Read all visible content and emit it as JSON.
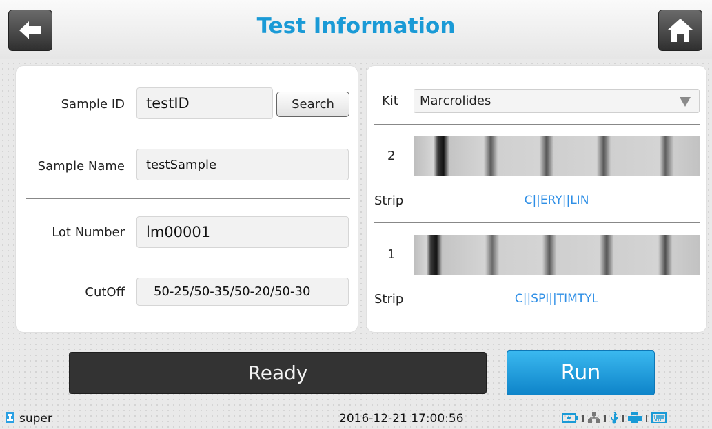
{
  "header": {
    "title": "Test Information",
    "back_icon": "arrow-left-icon",
    "home_icon": "home-icon"
  },
  "left_panel": {
    "sample_id_label": "Sample ID",
    "sample_id_value": "testID",
    "search_label": "Search",
    "sample_name_label": "Sample Name",
    "sample_name_value": "testSample",
    "lot_number_label": "Lot Number",
    "lot_number_value": "lm00001",
    "cutoff_label": "CutOff",
    "cutoff_value": "50-25/50-35/50-20/50-30"
  },
  "right_panel": {
    "kit_label": "Kit",
    "kit_value": "Marcrolides",
    "strips": [
      {
        "number": "2",
        "label": "Strip",
        "code": "C||ERY||LIN"
      },
      {
        "number": "1",
        "label": "Strip",
        "code": "C||SPI||TIMTYL"
      }
    ]
  },
  "footer": {
    "status_text": "Ready",
    "run_label": "Run"
  },
  "status_bar": {
    "username": "super",
    "datetime": "2016-12-21 17:00:56",
    "icons": [
      "battery-charging-icon",
      "network-icon",
      "usb-icon",
      "printer-icon",
      "keyboard-icon"
    ]
  },
  "colors": {
    "accent": "#1a9ad6",
    "strip_code": "#2f8fe6",
    "run_button": "#1aa0e0",
    "ready_bar": "#333333"
  }
}
